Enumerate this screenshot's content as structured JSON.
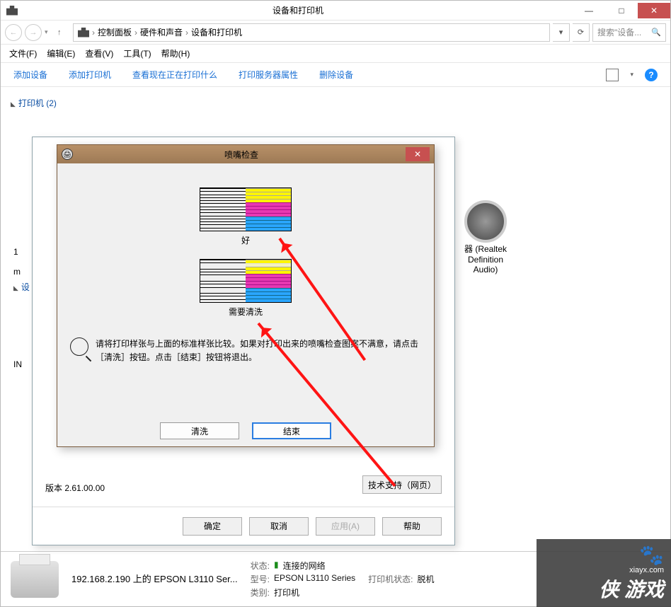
{
  "window": {
    "title": "设备和打印机",
    "sys": {
      "min": "—",
      "max": "□",
      "close": "✕"
    }
  },
  "nav": {
    "back": "←",
    "forward": "→",
    "dd": "▾",
    "up": "↑",
    "crumbs": [
      "控制面板",
      "硬件和声音",
      "设备和打印机"
    ],
    "refresh": "⟳",
    "dd2": "▾",
    "search_placeholder": "搜索\"设备...",
    "search_icon": "🔍"
  },
  "menu": [
    "文件(F)",
    "编辑(E)",
    "查看(V)",
    "工具(T)",
    "帮助(H)"
  ],
  "toolbar": {
    "items": [
      "添加设备",
      "添加打印机",
      "查看现在正在打印什么",
      "打印服务器属性",
      "删除设备"
    ],
    "view_dd": "▾",
    "help": "?"
  },
  "categories": {
    "printers": "打印机 (2)",
    "devices": "设"
  },
  "side": {
    "one": "1",
    "m": "m",
    "in": "IN"
  },
  "speaker": {
    "l1": "器 (Realtek",
    "l2": "Definition",
    "l3": "Audio)"
  },
  "props": {
    "version": "版本 2.61.00.00",
    "tech": "技术支持（网页）",
    "ok": "确定",
    "cancel": "取消",
    "apply": "应用(A)",
    "help": "帮助"
  },
  "nozzle": {
    "title": "喷嘴检查",
    "icon_txt": "🖨",
    "close": "✕",
    "good": "好",
    "need": "需要清洗",
    "instr": "请将打印样张与上面的标准样张比较。如果对打印出来的喷嘴检查图案不满意，请点击［清洗］按钮。点击［结束］按钮将退出。",
    "clean": "清洗",
    "finish": "结束"
  },
  "details": {
    "title": "192.168.2.190 上的 EPSON L3110 Ser...",
    "status_k": "状态:",
    "status_v": "连接的网络",
    "model_k": "型号:",
    "model_v": "EPSON L3110 Series",
    "cat_k": "类别:",
    "cat_v": "打印机",
    "pstat_k": "打印机状态:",
    "pstat_v": "脱机"
  },
  "wm": {
    "paw": "🐾",
    "site": "xiayx.com",
    "brand": "侠 游戏"
  }
}
